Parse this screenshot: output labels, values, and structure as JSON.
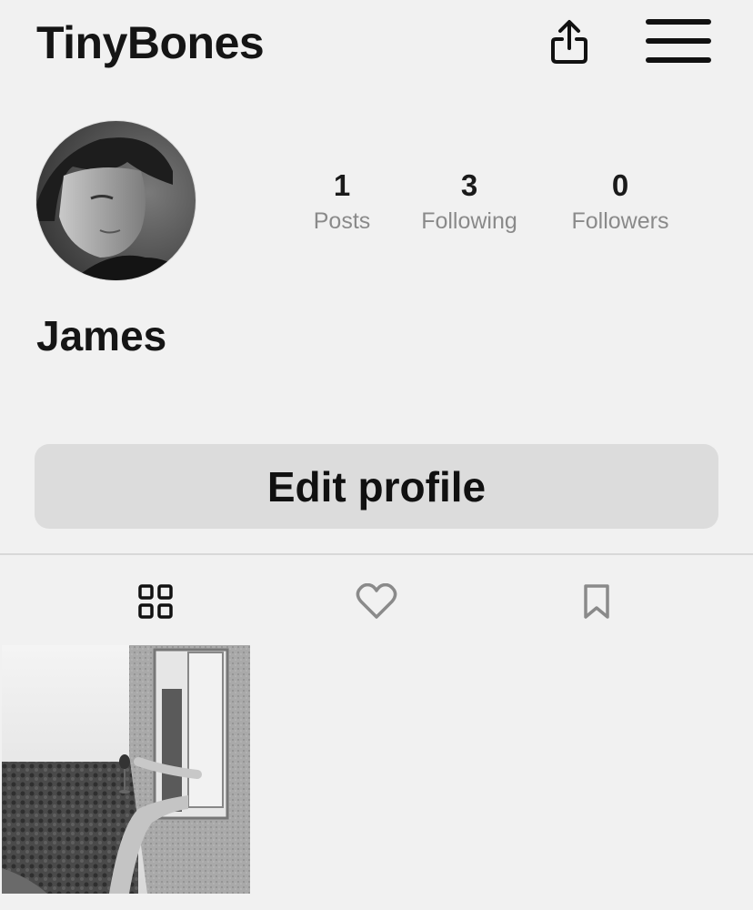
{
  "header": {
    "title": "TinyBones",
    "share_icon": "share-icon",
    "menu_icon": "hamburger-menu-icon"
  },
  "profile": {
    "name": "James",
    "stats": [
      {
        "value": "1",
        "label": "Posts"
      },
      {
        "value": "3",
        "label": "Following"
      },
      {
        "value": "0",
        "label": "Followers"
      }
    ],
    "edit_label": "Edit profile"
  },
  "tabs": [
    {
      "icon": "grid-icon",
      "active": true
    },
    {
      "icon": "heart-icon",
      "active": false
    },
    {
      "icon": "bookmark-icon",
      "active": false
    }
  ],
  "colors": {
    "background": "#f1f1f1",
    "button_bg": "#dcdcdc",
    "muted_text": "#8a8a8a",
    "active_icon": "#111111",
    "inactive_icon": "#8a8a8a"
  }
}
